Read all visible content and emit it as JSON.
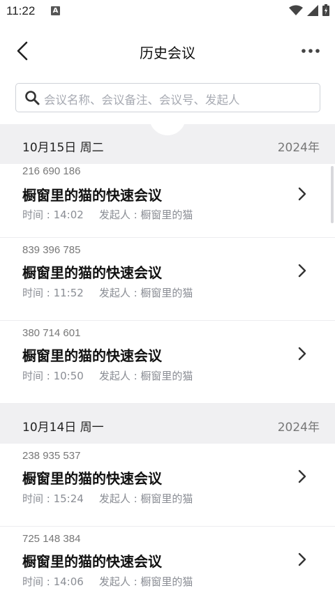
{
  "status_bar": {
    "time": "11:22",
    "notification_icon": "A"
  },
  "header": {
    "title": "历史会议"
  },
  "search": {
    "placeholder": "会议名称、会议备注、会议号、发起人"
  },
  "sections": [
    {
      "date": "10月15日 周二",
      "year": "2024年",
      "meetings": [
        {
          "id": "216 690 186",
          "name": "橱窗里的猫的快速会议",
          "time": "时间 : 14:02",
          "host": "发起人 : 橱窗里的猫"
        },
        {
          "id": "839 396 785",
          "name": "橱窗里的猫的快速会议",
          "time": "时间 : 11:52",
          "host": "发起人 : 橱窗里的猫"
        },
        {
          "id": "380 714 601",
          "name": "橱窗里的猫的快速会议",
          "time": "时间 : 10:50",
          "host": "发起人 : 橱窗里的猫"
        }
      ]
    },
    {
      "date": "10月14日 周一",
      "year": "2024年",
      "meetings": [
        {
          "id": "238 935 537",
          "name": "橱窗里的猫的快速会议",
          "time": "时间 : 15:24",
          "host": "发起人 : 橱窗里的猫"
        },
        {
          "id": "725 148 384",
          "name": "橱窗里的猫的快速会议",
          "time": "时间 : 14:06",
          "host": "发起人 : 橱窗里的猫"
        }
      ]
    }
  ]
}
